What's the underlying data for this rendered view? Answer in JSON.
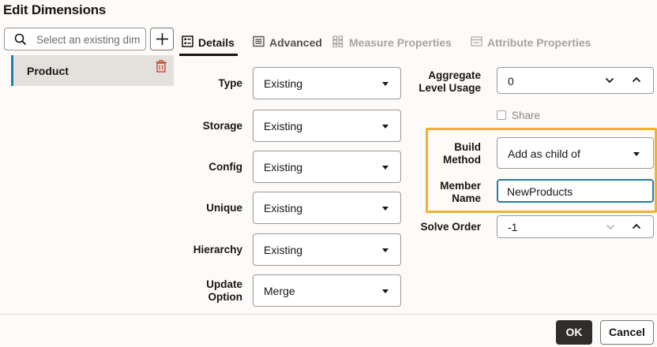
{
  "dialog": {
    "title": "Edit Dimensions"
  },
  "search": {
    "placeholder": "Select an existing dim"
  },
  "dimensions": [
    {
      "label": "Product"
    }
  ],
  "tabs": {
    "details": "Details",
    "advanced": "Advanced",
    "measure": "Measure Properties",
    "attribute": "Attribute Properties"
  },
  "form": {
    "type": {
      "label": "Type",
      "value": "Existing"
    },
    "storage": {
      "label": "Storage",
      "value": "Existing"
    },
    "config": {
      "label": "Config",
      "value": "Existing"
    },
    "unique": {
      "label": "Unique",
      "value": "Existing"
    },
    "hierarchy": {
      "label": "Hierarchy",
      "value": "Existing"
    },
    "update_option": {
      "label_line1": "Update",
      "label_line2": "Option",
      "value": "Merge"
    }
  },
  "right": {
    "aggregate": {
      "label_line1": "Aggregate",
      "label_line2": "Level Usage",
      "value": "0"
    },
    "share": {
      "label": "Share",
      "checked": false
    },
    "build_method": {
      "label_line1": "Build",
      "label_line2": "Method",
      "value": "Add as child of"
    },
    "member_name": {
      "label_line1": "Member",
      "label_line2": "Name",
      "value": "NewProducts"
    },
    "solve_order": {
      "label": "Solve Order",
      "value": "-1"
    }
  },
  "footer": {
    "ok": "OK",
    "cancel": "Cancel"
  },
  "colors": {
    "accent": "#227e9e",
    "highlight": "#efb22f",
    "primary_button": "#312d2a",
    "delete": "#c74634"
  }
}
